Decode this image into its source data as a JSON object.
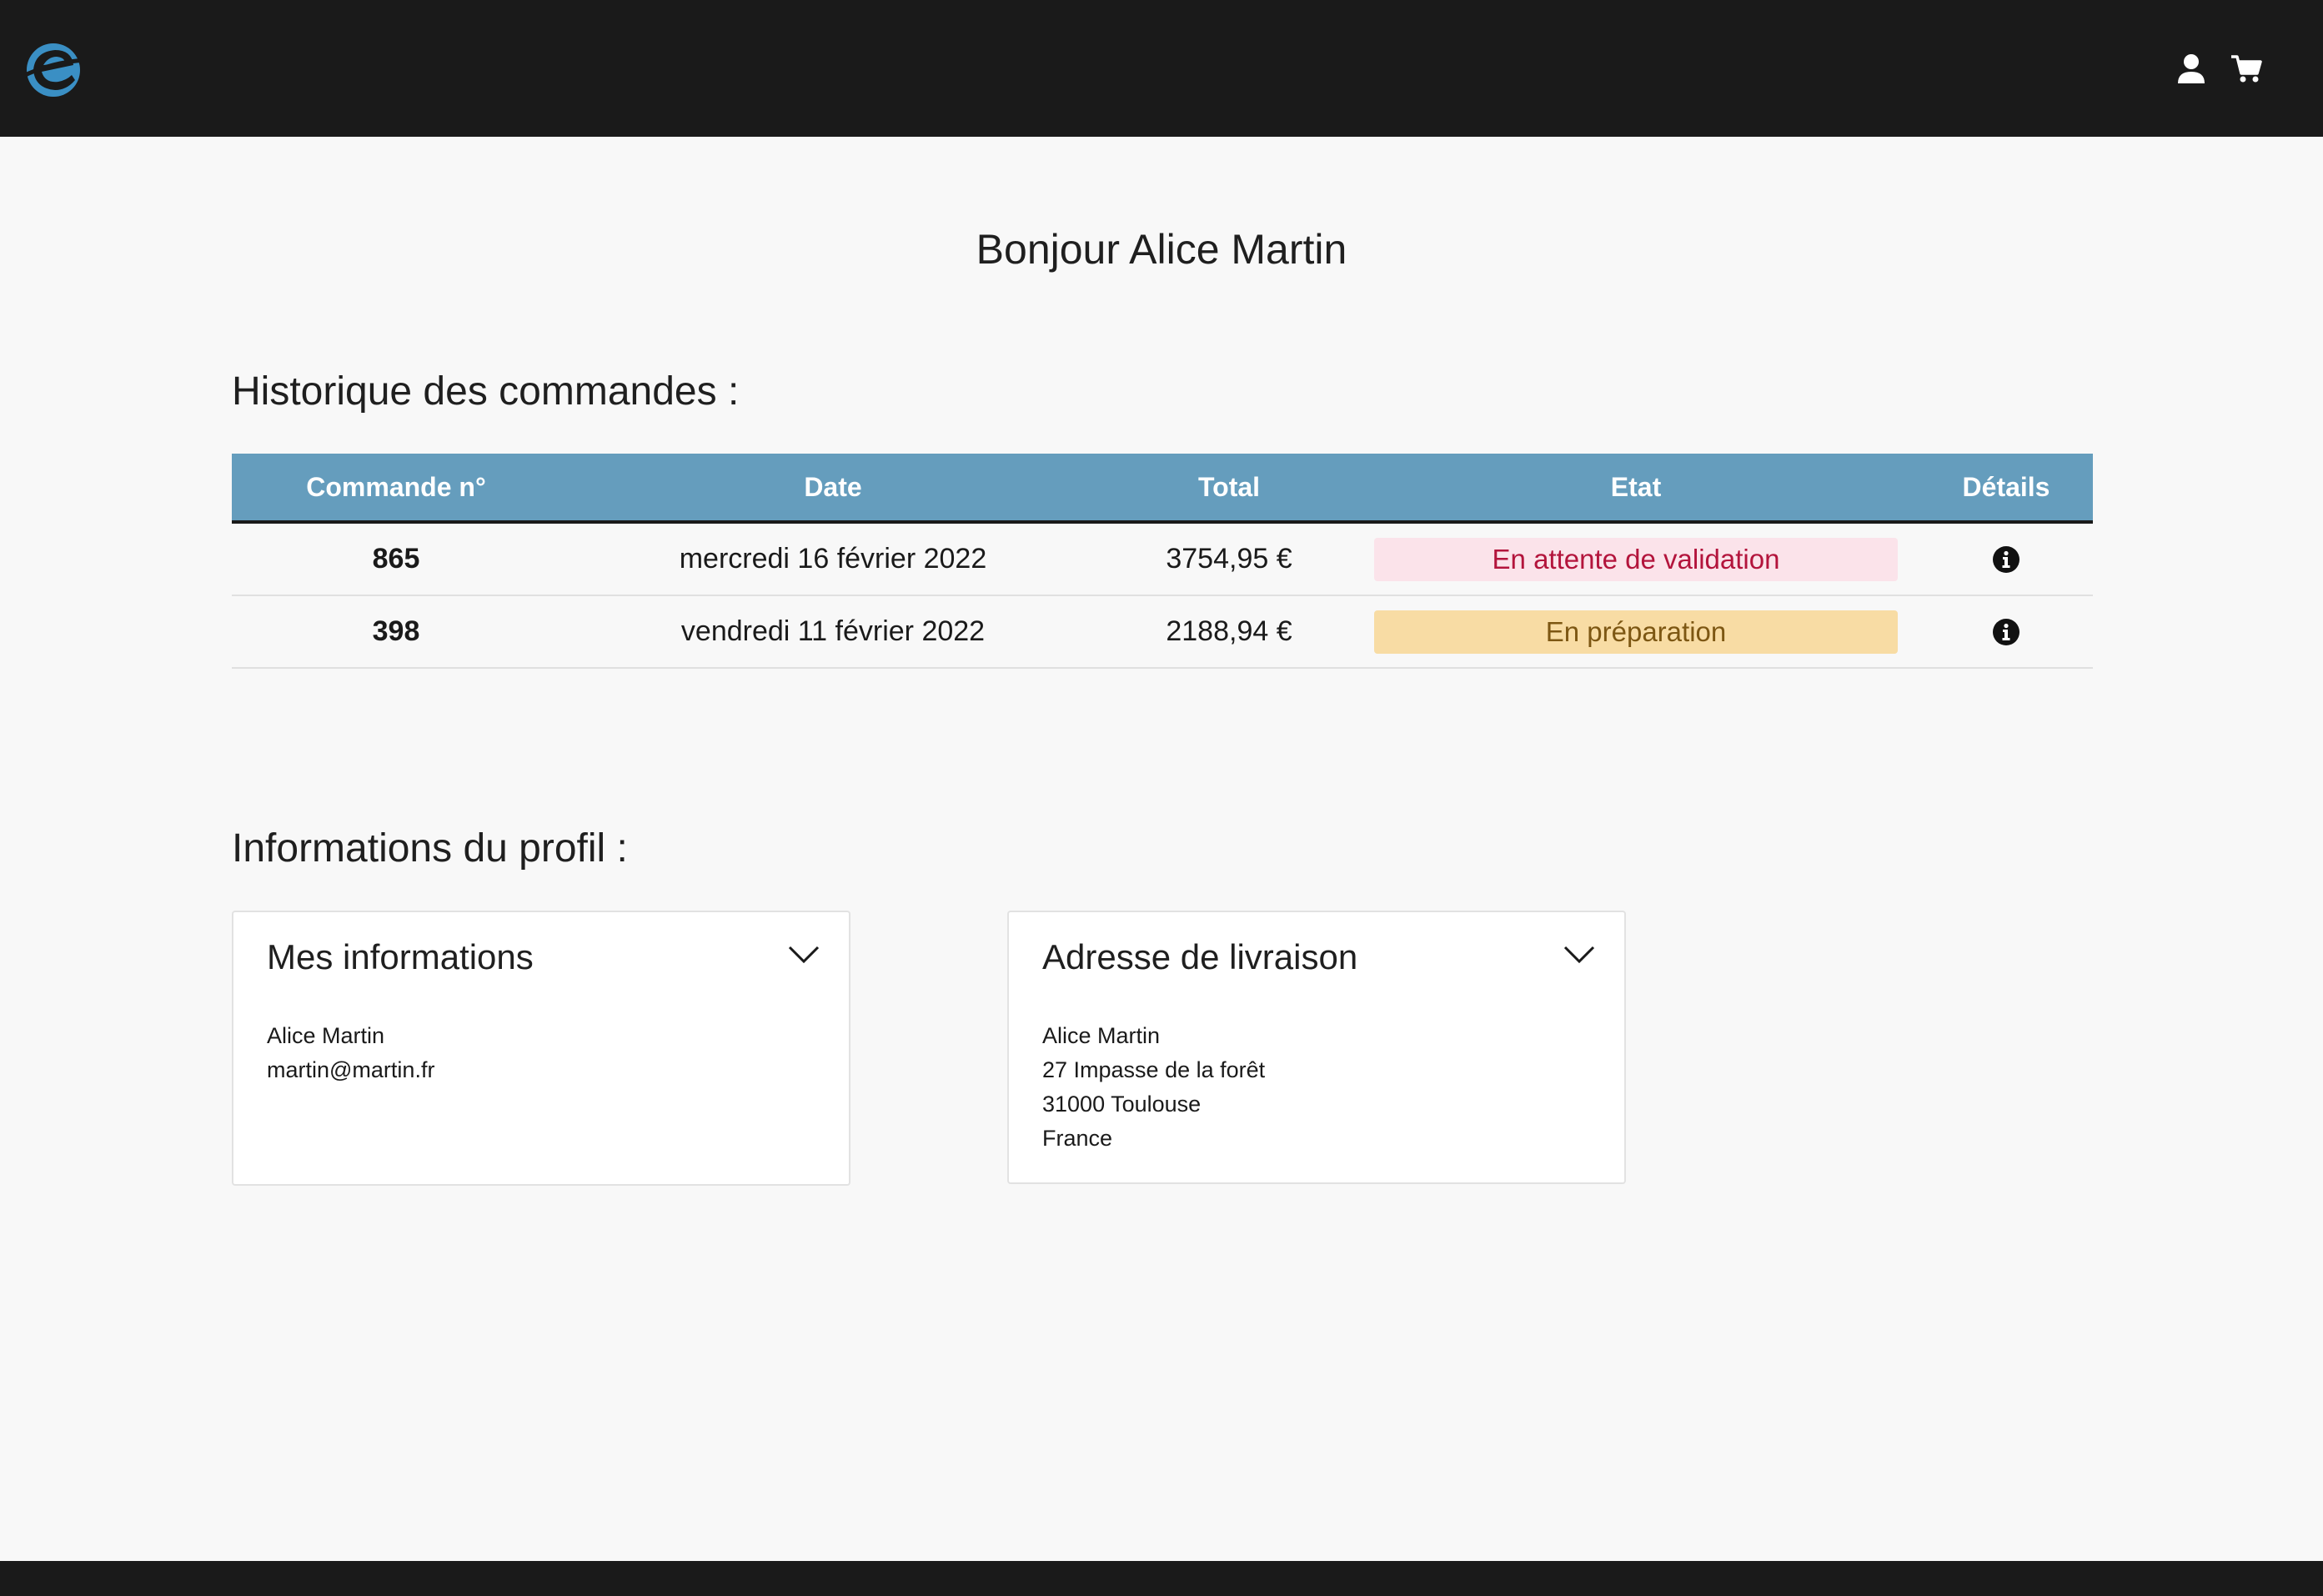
{
  "header": {
    "logo_icon": "e-logo-icon",
    "user_icon": "user-icon",
    "cart_icon": "shopping-cart-icon",
    "logo_color": "#3a8fc4",
    "background": "#1a1a1a"
  },
  "greeting": "Bonjour Alice Martin",
  "orders_section": {
    "title": "Historique des commandes :",
    "header_color": "#659dbd",
    "columns": [
      "Commande n°",
      "Date",
      "Total",
      "Etat",
      "Détails"
    ],
    "rows": [
      {
        "number": "865",
        "date": "mercredi 16 février 2022",
        "total": "3754,95 €",
        "status": "En attente de validation",
        "status_bg": "#fbe3ea",
        "status_color": "#b3143c",
        "details_icon": "info-circle-icon"
      },
      {
        "number": "398",
        "date": "vendredi 11 février 2022",
        "total": "2188,94 €",
        "status": "En préparation",
        "status_bg": "#f8dca4",
        "status_color": "#7d5713",
        "details_icon": "info-circle-icon"
      }
    ]
  },
  "profile_section": {
    "title": "Informations du profil :",
    "cards": [
      {
        "title": "Mes informations",
        "lines": [
          "Alice Martin",
          "martin@martin.fr"
        ]
      },
      {
        "title": "Adresse de livraison",
        "lines": [
          "Alice Martin",
          "27 Impasse de la forêt",
          "31000 Toulouse",
          "France"
        ]
      }
    ]
  }
}
